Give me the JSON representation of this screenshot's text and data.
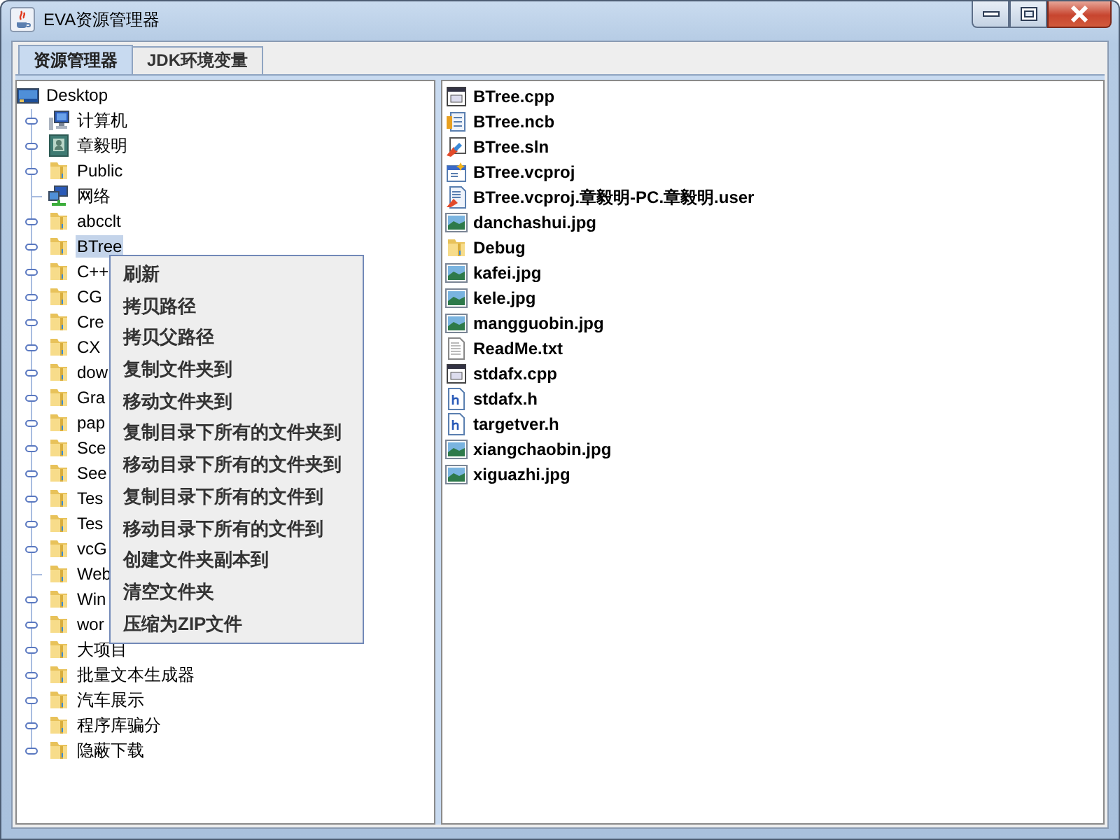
{
  "window": {
    "title": "EVA资源管理器"
  },
  "tabs": [
    {
      "label": "资源管理器",
      "selected": true
    },
    {
      "label": "JDK环境变量",
      "selected": false
    }
  ],
  "tree": {
    "label": "Desktop",
    "kind": "desktop",
    "selected": false,
    "children": [
      {
        "label": "计算机",
        "kind": "computer",
        "expandable": true,
        "selected": false
      },
      {
        "label": "章毅明",
        "kind": "user",
        "expandable": true,
        "selected": false
      },
      {
        "label": "Public",
        "kind": "folder",
        "expandable": true,
        "selected": false
      },
      {
        "label": "网络",
        "kind": "network",
        "expandable": false,
        "selected": false
      },
      {
        "label": "abcclt",
        "kind": "folder",
        "expandable": true,
        "selected": false
      },
      {
        "label": "BTree",
        "kind": "folder",
        "expandable": true,
        "selected": true
      },
      {
        "label": "C++",
        "kind": "folder",
        "expandable": true,
        "selected": false
      },
      {
        "label": "CG",
        "kind": "folder",
        "expandable": true,
        "selected": false
      },
      {
        "label": "Cre",
        "kind": "folder",
        "expandable": true,
        "selected": false
      },
      {
        "label": "CX",
        "kind": "folder",
        "expandable": true,
        "selected": false
      },
      {
        "label": "dow",
        "kind": "folder",
        "expandable": true,
        "selected": false
      },
      {
        "label": "Gra",
        "kind": "folder",
        "expandable": true,
        "selected": false
      },
      {
        "label": "pap",
        "kind": "folder",
        "expandable": true,
        "selected": false
      },
      {
        "label": "Sce",
        "kind": "folder",
        "expandable": true,
        "selected": false
      },
      {
        "label": "See",
        "kind": "folder",
        "expandable": true,
        "selected": false
      },
      {
        "label": "Tes",
        "kind": "folder",
        "expandable": true,
        "selected": false
      },
      {
        "label": "Tes",
        "kind": "folder",
        "expandable": true,
        "selected": false
      },
      {
        "label": "vcG",
        "kind": "folder",
        "expandable": true,
        "selected": false
      },
      {
        "label": "Web",
        "kind": "folder",
        "expandable": false,
        "selected": false
      },
      {
        "label": "Win",
        "kind": "folder",
        "expandable": true,
        "selected": false
      },
      {
        "label": "wor",
        "kind": "folder",
        "expandable": true,
        "selected": false
      },
      {
        "label": "大项目",
        "kind": "folder",
        "expandable": true,
        "selected": false
      },
      {
        "label": "批量文本生成器",
        "kind": "folder",
        "expandable": true,
        "selected": false
      },
      {
        "label": "汽车展示",
        "kind": "folder",
        "expandable": true,
        "selected": false
      },
      {
        "label": "程序库骗分",
        "kind": "folder",
        "expandable": true,
        "selected": false
      },
      {
        "label": "隐蔽下载",
        "kind": "folder",
        "expandable": true,
        "selected": false
      }
    ]
  },
  "context_menu": [
    "刷新",
    "拷贝路径",
    "拷贝父路径",
    "复制文件夹到",
    "移动文件夹到",
    "复制目录下所有的文件夹到",
    "移动目录下所有的文件夹到",
    "复制目录下所有的文件到",
    "移动目录下所有的文件到",
    "创建文件夹副本到",
    "清空文件夹",
    "压缩为ZIP文件"
  ],
  "files": [
    {
      "name": "BTree.cpp",
      "kind": "cpp"
    },
    {
      "name": "BTree.ncb",
      "kind": "ncb"
    },
    {
      "name": "BTree.sln",
      "kind": "sln"
    },
    {
      "name": "BTree.vcproj",
      "kind": "vcproj"
    },
    {
      "name": "BTree.vcproj.章毅明-PC.章毅明.user",
      "kind": "user"
    },
    {
      "name": "danchashui.jpg",
      "kind": "image"
    },
    {
      "name": "Debug",
      "kind": "folder"
    },
    {
      "name": "kafei.jpg",
      "kind": "image"
    },
    {
      "name": "kele.jpg",
      "kind": "image"
    },
    {
      "name": "mangguobin.jpg",
      "kind": "image"
    },
    {
      "name": "ReadMe.txt",
      "kind": "text"
    },
    {
      "name": "stdafx.cpp",
      "kind": "cpp"
    },
    {
      "name": "stdafx.h",
      "kind": "header"
    },
    {
      "name": "targetver.h",
      "kind": "header"
    },
    {
      "name": "xiangchaobin.jpg",
      "kind": "image"
    },
    {
      "name": "xiguazhi.jpg",
      "kind": "image"
    }
  ]
}
